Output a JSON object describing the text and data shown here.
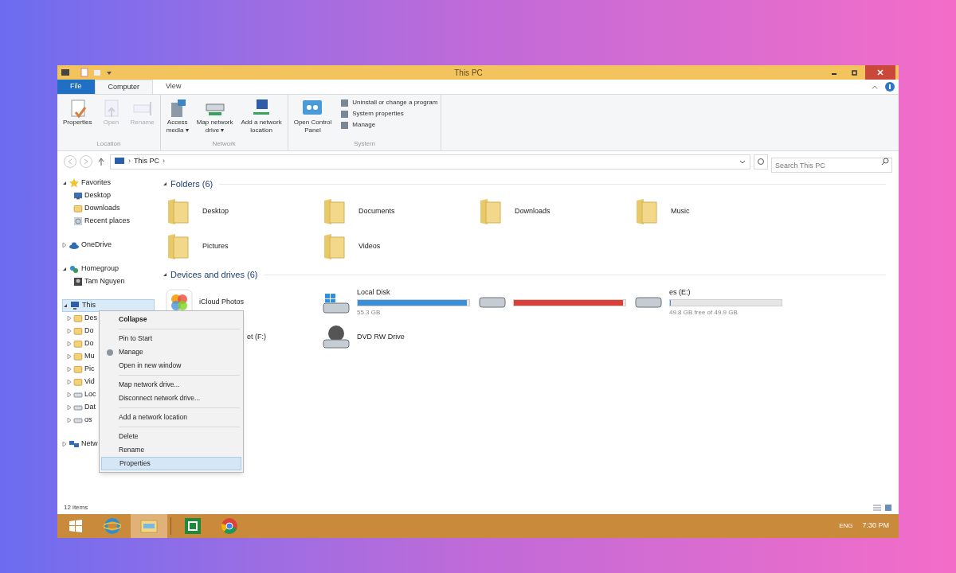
{
  "window": {
    "title": "This PC"
  },
  "ribbon": {
    "tabs": [
      {
        "label": "File",
        "kind": "file",
        "selected": false
      },
      {
        "label": "Computer",
        "kind": "tab",
        "selected": true
      },
      {
        "label": "View",
        "kind": "tab",
        "selected": false
      }
    ],
    "groups": [
      {
        "label": "Location",
        "buttons": [
          {
            "lines": [
              "Properties"
            ],
            "disabled": false
          },
          {
            "lines": [
              "Open"
            ],
            "disabled": true
          },
          {
            "lines": [
              "Rename"
            ],
            "disabled": true
          }
        ]
      },
      {
        "label": "Network",
        "buttons": [
          {
            "lines": [
              "Access",
              "media ▾"
            ],
            "disabled": false
          },
          {
            "lines": [
              "Map network",
              "drive ▾"
            ],
            "disabled": false
          },
          {
            "lines": [
              "Add a network",
              "location"
            ],
            "disabled": false
          }
        ]
      },
      {
        "label": "System",
        "buttons": [
          {
            "lines": [
              "Open Control",
              "Panel"
            ],
            "disabled": false
          }
        ],
        "small": [
          "Uninstall or change a program",
          "System properties",
          "Manage"
        ]
      }
    ]
  },
  "address": {
    "segments": [
      {
        "kind": "separator",
        "text": "›"
      },
      {
        "kind": "location",
        "text": "This PC"
      },
      {
        "kind": "separator",
        "text": "›"
      }
    ],
    "search_placeholder": "Search This PC"
  },
  "nav_tree": [
    {
      "label": "Favorites",
      "expanded": true,
      "selected": false,
      "children": [
        {
          "label": "Desktop"
        },
        {
          "label": "Downloads"
        },
        {
          "label": "Recent places"
        }
      ]
    },
    {
      "label": "OneDrive",
      "expanded": false,
      "selected": false
    },
    {
      "label": "Homegroup",
      "expanded": true,
      "selected": false,
      "children": [
        {
          "label": "Tam Nguyen"
        }
      ]
    },
    {
      "label": "This",
      "expanded": true,
      "selected": true,
      "children": [
        {
          "label": "Des"
        },
        {
          "label": "Do"
        },
        {
          "label": "Do"
        },
        {
          "label": "Mu"
        },
        {
          "label": "Pic"
        },
        {
          "label": "Vid"
        },
        {
          "label": "Loc"
        },
        {
          "label": "Dat"
        },
        {
          "label": "os"
        }
      ]
    },
    {
      "label": "Netw",
      "expanded": false,
      "selected": false
    }
  ],
  "folders": {
    "heading": "Folders (6)",
    "items": [
      "Desktop",
      "Documents",
      "Downloads",
      "Music",
      "Pictures",
      "Videos"
    ]
  },
  "drives": {
    "heading": "Devices and drives (6)",
    "items": [
      {
        "name": "iCloud Photos",
        "kind": "app"
      },
      {
        "name": "Local Disk",
        "kind": "disk",
        "level": 0.98,
        "color": "#3b8fd6",
        "detail": "55.3 GB"
      },
      {
        "kind": "disk",
        "level": 0.98,
        "color": "#d9403a"
      },
      {
        "name": "es (E:)",
        "kind": "disk",
        "level": 0.01,
        "color": "#3b8fd6",
        "detail": "49.8 GB free of 49.9 GB"
      },
      {
        "name": "et (F:)",
        "kind": "usb"
      },
      {
        "name": "DVD RW Drive",
        "kind": "dvd"
      }
    ]
  },
  "context_menu": {
    "groups": [
      [
        {
          "label": "Collapse",
          "bold": true,
          "selected": false
        }
      ],
      [
        {
          "label": "Pin to Start",
          "bold": false,
          "selected": false
        },
        {
          "label": "Manage",
          "bold": false,
          "selected": false
        },
        {
          "label": "Open in new window",
          "bold": false,
          "selected": false
        }
      ],
      [
        {
          "label": "Map network drive...",
          "bold": false,
          "selected": false
        },
        {
          "label": "Disconnect network drive...",
          "bold": false,
          "selected": false
        }
      ],
      [
        {
          "label": "Add a network location",
          "bold": false,
          "selected": false
        }
      ],
      [
        {
          "label": "Delete",
          "bold": false,
          "selected": false
        },
        {
          "label": "Rename",
          "bold": false,
          "selected": false
        },
        {
          "label": "Properties",
          "bold": false,
          "selected": true
        }
      ]
    ]
  },
  "status_bar": {
    "text": "12 items"
  },
  "taskbar": {
    "apps": [
      {
        "kind": "ie",
        "selected": false
      },
      {
        "kind": "explorer",
        "selected": true
      },
      {
        "kind": "store",
        "selected": false
      },
      {
        "kind": "chrome",
        "selected": false
      }
    ],
    "language": "ENG",
    "time": "7:30 PM"
  }
}
